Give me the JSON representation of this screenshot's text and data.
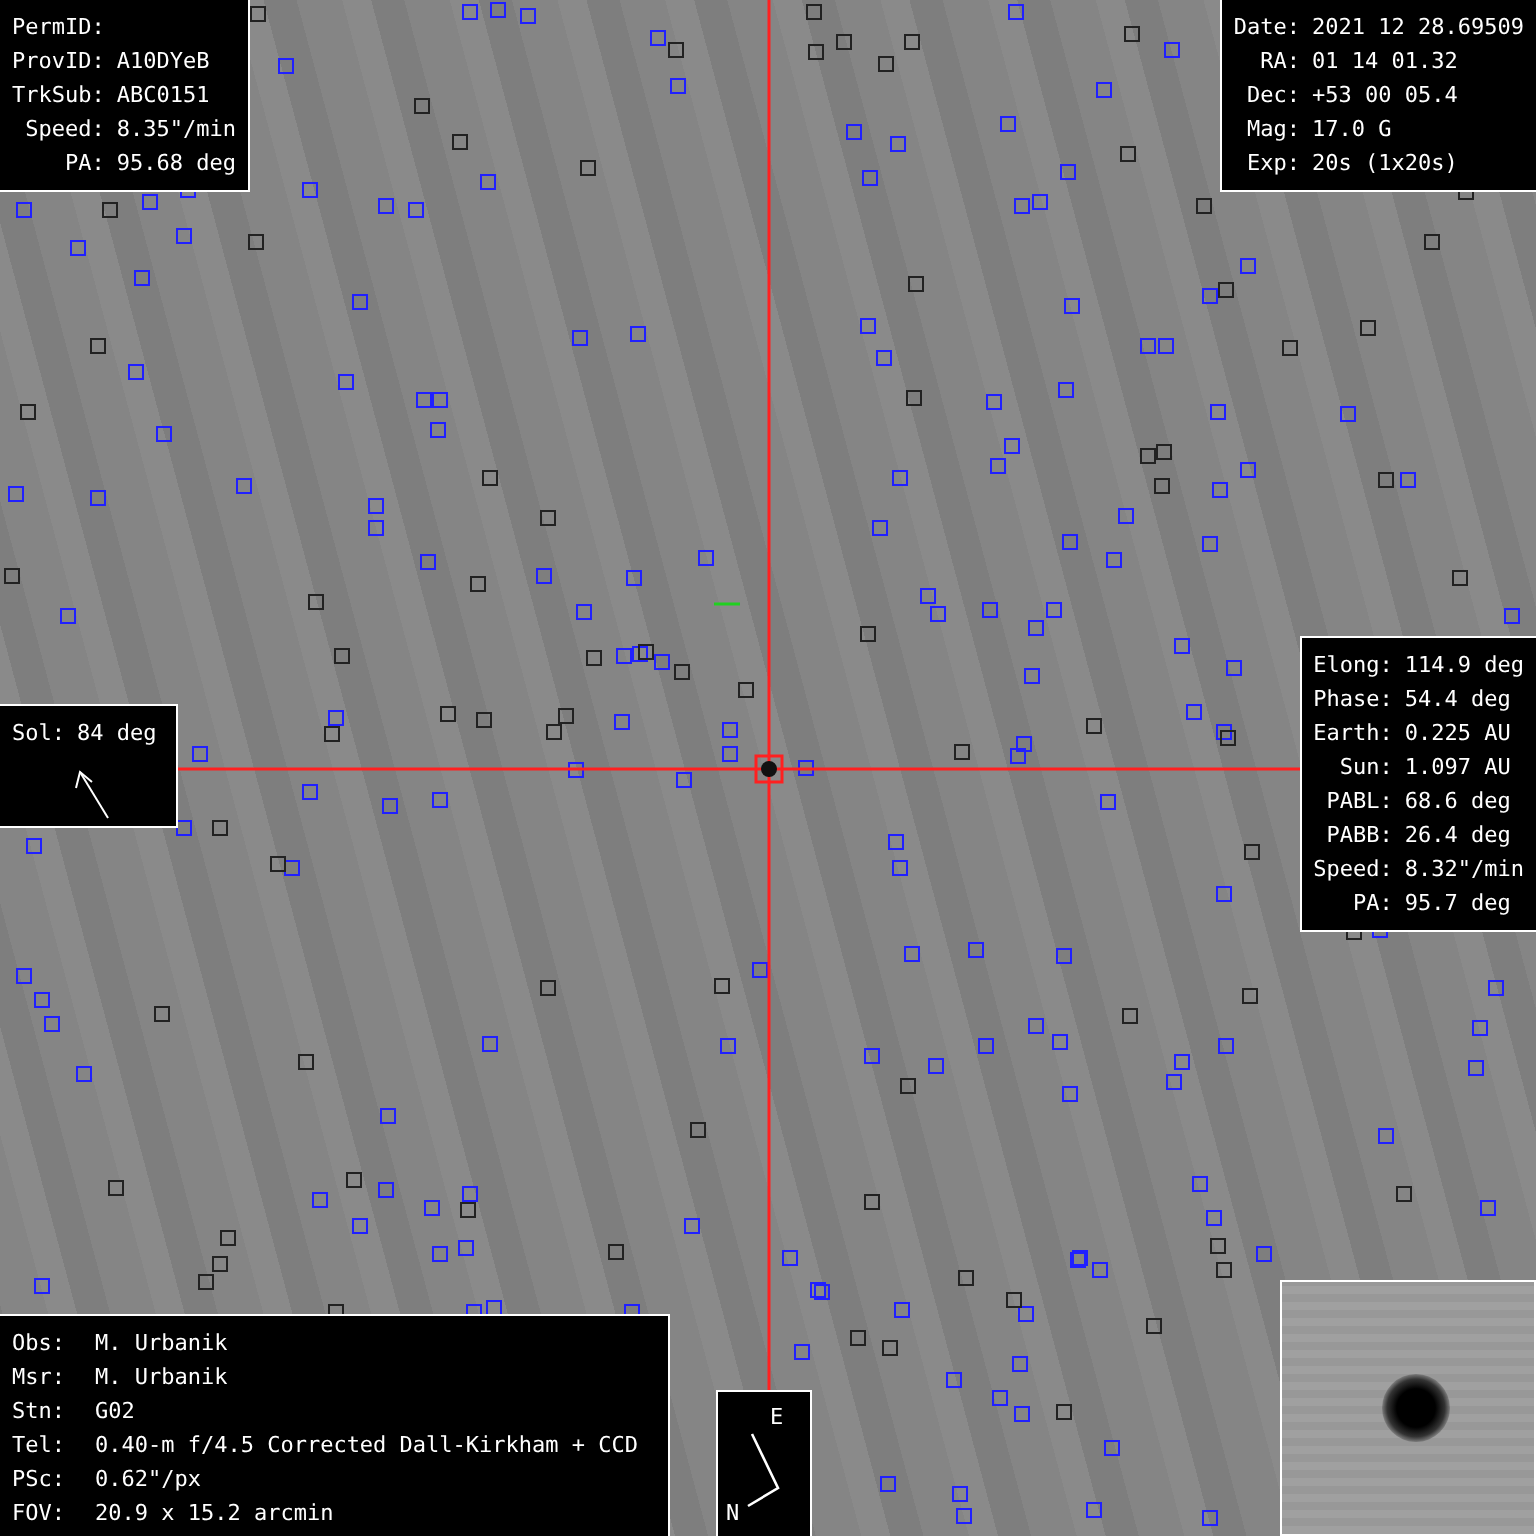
{
  "object_panel": [
    {
      "label": "PermID:"
    },
    {
      "label": "ProvID:",
      "value": "A10DYeB"
    },
    {
      "label": "TrkSub:",
      "value": "ABC0151"
    },
    {
      "label": "Speed:",
      "value": "8.35\"/min"
    },
    {
      "label": "PA:",
      "value": "95.68 deg"
    }
  ],
  "observation_panel": [
    {
      "label": "Date:",
      "value": "2021 12 28.69509"
    },
    {
      "label": "RA:",
      "value": "01 14 01.32"
    },
    {
      "label": "Dec:",
      "value": "+53 00 05.4"
    },
    {
      "label": "Mag:",
      "value": "17.0 G"
    },
    {
      "label": "Exp:",
      "value": "20s (1x20s)"
    }
  ],
  "geometry_panel": [
    {
      "label": "Elong:",
      "value": "114.9 deg"
    },
    {
      "label": "Phase:",
      "value": "54.4 deg"
    },
    {
      "label": "Earth:",
      "value": "0.225 AU"
    },
    {
      "label": "Sun:",
      "value": "1.097 AU"
    },
    {
      "label": "PABL:",
      "value": "68.6 deg"
    },
    {
      "label": "PABB:",
      "value": "26.4 deg"
    },
    {
      "label": "Speed:",
      "value": "8.32\"/min"
    },
    {
      "label": "PA:",
      "value": "95.7 deg"
    }
  ],
  "sol_panel": {
    "label": "Sol:",
    "value": "84 deg"
  },
  "observer_panel": [
    {
      "label": "Obs:",
      "value": "M. Urbanik"
    },
    {
      "label": "Msr:",
      "value": "M. Urbanik"
    },
    {
      "label": "Stn:",
      "value": "G02"
    },
    {
      "label": "Tel:",
      "value": "0.40-m f/4.5 Corrected Dall-Kirkham + CCD"
    },
    {
      "label": "PSc:",
      "value": "0.62\"/px"
    },
    {
      "label": "FOV:",
      "value": "20.9 x 15.2 arcmin"
    }
  ],
  "compass": {
    "east": "E",
    "north": "N"
  }
}
